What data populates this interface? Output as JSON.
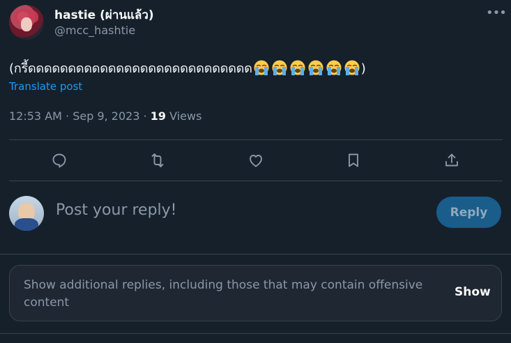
{
  "tweet": {
    "author_name": "hastie (ผ่านแล้ว)",
    "author_handle": "@mcc_hashtie",
    "text": "(กรี้ดดดดดดดดดดดดดดดดดดดดดดดดดดดด",
    "text_end": ")",
    "emoji": [
      "loudly-crying-face",
      "loudly-crying-face",
      "loudly-crying-face",
      "loudly-crying-face",
      "loudly-crying-face",
      "loudly-crying-face"
    ],
    "translate_label": "Translate post",
    "timestamp": "12:53 AM · Sep 9, 2023 · ",
    "views_count": "19",
    "views_label": " Views"
  },
  "actions": [
    "reply-icon",
    "retweet-icon",
    "like-icon",
    "bookmark-icon",
    "share-icon"
  ],
  "composer": {
    "placeholder": "Post your reply!",
    "reply_button": "Reply"
  },
  "more_replies": {
    "text": "Show additional replies, including those that may contain offensive content",
    "show_button": "Show"
  },
  "colors": {
    "background": "#15202b",
    "accent": "#1d9bf0",
    "muted": "#8b98a5",
    "divider": "#38444d"
  }
}
